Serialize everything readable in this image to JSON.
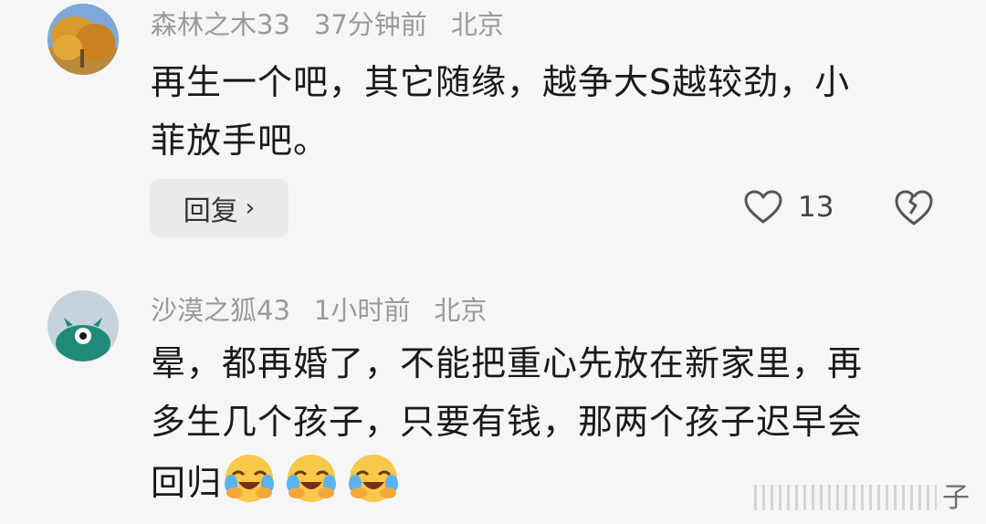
{
  "comments": [
    {
      "username": "森林之木33",
      "time": "37分钟前",
      "location": "北京",
      "lines": [
        "再生一个吧，其它随缘，越争大S越较劲，小",
        "菲放手吧。"
      ],
      "reply_label": "回复",
      "reply_chevron": "›",
      "like_count": "13",
      "avatar_icon": "autumn-tree-avatar"
    },
    {
      "username": "沙漠之狐43",
      "time": "1小时前",
      "location": "北京",
      "lines": [
        "晕，都再婚了，不能把重心先放在新家里，再",
        "多生几个孩子，只要有钱，那两个孩子迟早会",
        "回归"
      ],
      "emojis": [
        "laughing-crying-emoji",
        "laughing-crying-emoji",
        "laughing-crying-emoji"
      ],
      "avatar_icon": "green-monster-avatar"
    }
  ],
  "watermark": "子",
  "colors": {
    "background": "#f6f6f6",
    "meta_text": "#9a9a9a",
    "body_text": "#1a1a1a",
    "reply_bg": "#ebebeb"
  }
}
